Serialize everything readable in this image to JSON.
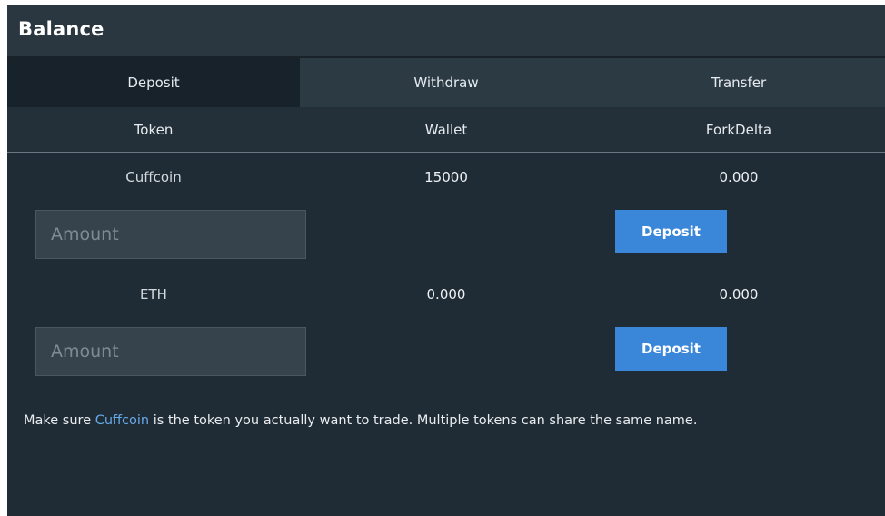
{
  "panel": {
    "title": "Balance"
  },
  "tabs": [
    {
      "label": "Deposit",
      "active": true
    },
    {
      "label": "Withdraw",
      "active": false
    },
    {
      "label": "Transfer",
      "active": false
    }
  ],
  "columns": [
    "Token",
    "Wallet",
    "ForkDelta"
  ],
  "rows": [
    {
      "token": "Cuffcoin",
      "wallet": "15000",
      "exchange": "0.000",
      "amount_placeholder": "Amount",
      "button_label": "Deposit"
    },
    {
      "token": "ETH",
      "wallet": "0.000",
      "exchange": "0.000",
      "amount_placeholder": "Amount",
      "button_label": "Deposit"
    }
  ],
  "notice": {
    "prefix": "Make sure ",
    "token": "Cuffcoin",
    "suffix": " is the token you actually want to trade. Multiple tokens can share the same name."
  },
  "colors": {
    "panel_bg": "#1f2b35",
    "header_bg": "#2b3740",
    "active_tab_bg": "#17222b",
    "tab_bg": "#2c3a44",
    "button_bg": "#3a87d9",
    "link": "#66a9e8"
  }
}
